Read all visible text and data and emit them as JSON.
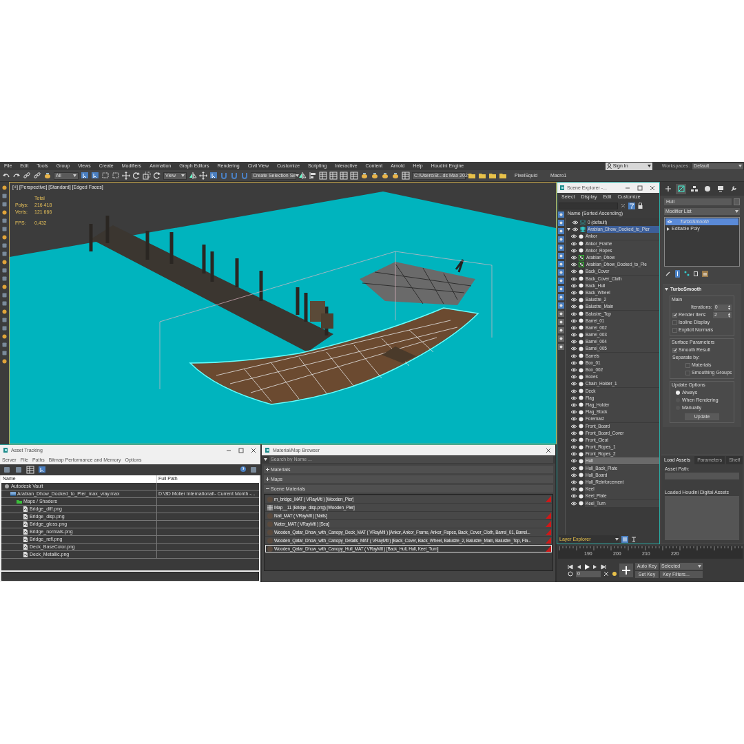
{
  "menu": [
    "File",
    "Edit",
    "Tools",
    "Group",
    "Views",
    "Create",
    "Modifiers",
    "Animation",
    "Graph Editors",
    "Rendering",
    "Civil View",
    "Customize",
    "Scripting",
    "Interactive",
    "Content",
    "Arnold",
    "Help",
    "Houdini Engine"
  ],
  "account": {
    "sign_in": "Sign In",
    "workspaces_label": "Workspaces:",
    "workspace": "Default"
  },
  "toolbar": {
    "selection_filter": "All",
    "reference_coord": "View",
    "selection_set": "Create Selection Se",
    "project_path": "C:\\Users\\St...ds Max 202",
    "buttons": [
      "PixelSquid",
      "Macro1"
    ]
  },
  "viewport": {
    "label": "[+] [Perspective] [Standard] [Edged Faces]",
    "total": "Total",
    "stats": [
      {
        "label": "Polys:",
        "value": "216 418"
      },
      {
        "label": "Verts:",
        "value": "121 666"
      }
    ],
    "fps_label": "FPS:",
    "fps": "0,432"
  },
  "scene_explorer": {
    "title": "Scene Explorer -...",
    "menu": [
      "Select",
      "Display",
      "Edit",
      "Customize"
    ],
    "column": "Name (Sorted Ascending)",
    "footer": "Layer Explorer",
    "tree": [
      {
        "name": "0 (default)",
        "kind": "layer",
        "selected": false
      },
      {
        "name": "Arabian_Dhow_Docked_to_Pier",
        "kind": "layer",
        "selected": true,
        "expanded": true,
        "children": [
          {
            "name": "Ankor",
            "kind": "object",
            "selected": false
          },
          {
            "name": "Ankor_Frame",
            "kind": "object",
            "selected": false
          },
          {
            "name": "Ankor_Ropes",
            "kind": "object",
            "selected": false
          },
          {
            "name": "Arabian_Dhow",
            "kind": "group",
            "selected": false
          },
          {
            "name": "Arabian_Dhow_Docked_to_Pie",
            "kind": "group",
            "selected": false
          },
          {
            "name": "Back_Cover",
            "kind": "object",
            "selected": false
          },
          {
            "name": "Back_Cover_Cloth",
            "kind": "object",
            "selected": false
          },
          {
            "name": "Back_Hull",
            "kind": "object",
            "selected": false
          },
          {
            "name": "Back_Wheel",
            "kind": "object",
            "selected": false
          },
          {
            "name": "Balustre_2",
            "kind": "object",
            "selected": false
          },
          {
            "name": "Balustre_Main",
            "kind": "object",
            "selected": false
          },
          {
            "name": "Balustre_Top",
            "kind": "object",
            "selected": false
          },
          {
            "name": "Barrel_01",
            "kind": "object",
            "selected": false
          },
          {
            "name": "Barrel_002",
            "kind": "object",
            "selected": false
          },
          {
            "name": "Barrel_003",
            "kind": "object",
            "selected": false
          },
          {
            "name": "Barrel_004",
            "kind": "object",
            "selected": false
          },
          {
            "name": "Barrel_005",
            "kind": "object",
            "selected": false
          },
          {
            "name": "Barrels",
            "kind": "object",
            "selected": false
          },
          {
            "name": "Box_01",
            "kind": "object",
            "selected": false
          },
          {
            "name": "Box_002",
            "kind": "object",
            "selected": false
          },
          {
            "name": "Boxes",
            "kind": "object",
            "selected": false
          },
          {
            "name": "Chain_Holder_1",
            "kind": "object",
            "selected": false
          },
          {
            "name": "Deck",
            "kind": "object",
            "selected": false
          },
          {
            "name": "Flag",
            "kind": "object",
            "selected": false
          },
          {
            "name": "Flag_Holder",
            "kind": "object",
            "selected": false
          },
          {
            "name": "Flag_Stock",
            "kind": "object",
            "selected": false
          },
          {
            "name": "Foremast",
            "kind": "object",
            "selected": false
          },
          {
            "name": "Front_Board",
            "kind": "object",
            "selected": false
          },
          {
            "name": "Front_Board_Cover",
            "kind": "object",
            "selected": false
          },
          {
            "name": "Front_Cleat",
            "kind": "object",
            "selected": false
          },
          {
            "name": "Front_Ropes_1",
            "kind": "object",
            "selected": false
          },
          {
            "name": "Front_Ropes_2",
            "kind": "object",
            "selected": false
          },
          {
            "name": "Hull",
            "kind": "object",
            "selected": true
          },
          {
            "name": "Hull_Back_Plate",
            "kind": "object",
            "selected": false
          },
          {
            "name": "Hull_Board",
            "kind": "object",
            "selected": false
          },
          {
            "name": "Hull_Reinforcement",
            "kind": "object",
            "selected": false
          },
          {
            "name": "Keel",
            "kind": "object",
            "selected": false
          },
          {
            "name": "Keel_Plate",
            "kind": "object",
            "selected": false
          },
          {
            "name": "Keel_Turn",
            "kind": "object",
            "selected": false
          }
        ]
      }
    ]
  },
  "command_panel": {
    "tabs": [
      {
        "kind": "create",
        "selected": false
      },
      {
        "kind": "modify",
        "selected": true
      },
      {
        "kind": "hierarchy",
        "selected": false
      },
      {
        "kind": "motion",
        "selected": false
      },
      {
        "kind": "display",
        "selected": false
      },
      {
        "kind": "utilities",
        "selected": false
      }
    ],
    "object_name": "Hull",
    "modifier_list": "Modifier List",
    "stack": [
      {
        "name": "TurboSmooth",
        "kind": "modifier",
        "selected": true
      },
      {
        "name": "Editable Poly",
        "kind": "base",
        "selected": false
      }
    ],
    "rollout": {
      "title": "TurboSmooth",
      "groups": [
        {
          "title": "Main",
          "controls": [
            {
              "kind": "spinner",
              "label": "Iterations:",
              "value": "0"
            },
            {
              "kind": "checked_spinner",
              "label": "Render Iters:",
              "value": "2",
              "checked": true
            },
            {
              "kind": "checkbox",
              "label": "Isoline Display",
              "checked": false
            },
            {
              "kind": "checkbox",
              "label": "Explicit Normals",
              "checked": false
            }
          ]
        },
        {
          "title": "Surface Parameters",
          "controls": [
            {
              "kind": "checkbox",
              "label": "Smooth Result",
              "checked": true
            },
            {
              "kind": "label",
              "label": "Separate by:"
            },
            {
              "kind": "sub_checkbox",
              "label": "Materials",
              "checked": false
            },
            {
              "kind": "sub_checkbox",
              "label": "Smoothing Groups",
              "checked": false
            }
          ]
        },
        {
          "title": "Update Options",
          "controls": [
            {
              "kind": "radio",
              "label": "Always",
              "selected": true
            },
            {
              "kind": "radio",
              "label": "When Rendering",
              "selected": false
            },
            {
              "kind": "radio",
              "label": "Manually",
              "selected": false
            },
            {
              "kind": "button",
              "label": "Update"
            }
          ]
        }
      ]
    },
    "houdini": {
      "tabs": [
        {
          "label": "Load Assets",
          "selected": true
        },
        {
          "label": "Parameters",
          "selected": false
        },
        {
          "label": "Shelf",
          "selected": false
        }
      ],
      "asset_path_label": "Asset Path:",
      "loaded_label": "Loaded Houdini Digital Assets"
    }
  },
  "asset_tracking": {
    "title": "Asset Tracking",
    "menu": [
      "Server",
      "File",
      "Paths",
      "Bitmap Performance and Memory",
      "Options"
    ],
    "columns": [
      "Name",
      "Full Path"
    ],
    "tree": [
      {
        "name": "Autodesk Vault",
        "kind": "vault",
        "children": [
          {
            "name": "Arabian_Dhow_Docked_to_Pier_max_vray.max",
            "kind": "scene",
            "path": "D:\\3D Molier International\\- Current Month -...",
            "children": [
              {
                "name": "Maps / Shaders",
                "kind": "folder",
                "children": [
                  {
                    "name": "Bridge_diff.png",
                    "kind": "bitmap"
                  },
                  {
                    "name": "Bridge_disp.png",
                    "kind": "bitmap"
                  },
                  {
                    "name": "Bridge_gloss.png",
                    "kind": "bitmap"
                  },
                  {
                    "name": "Bridge_normals.png",
                    "kind": "bitmap"
                  },
                  {
                    "name": "Bridge_refl.png",
                    "kind": "bitmap"
                  },
                  {
                    "name": "Deck_BaseColor.png",
                    "kind": "bitmap"
                  },
                  {
                    "name": "Deck_Metallic.png",
                    "kind": "bitmap"
                  }
                ]
              }
            ]
          }
        ]
      }
    ]
  },
  "material_browser": {
    "title": "Material/Map Browser",
    "search_placeholder": "Search by Name ...",
    "sections": [
      {
        "label": "Materials",
        "expanded": false
      },
      {
        "label": "Maps",
        "expanded": false
      },
      {
        "label": "Scene Materials",
        "expanded": true
      }
    ],
    "items": [
      {
        "name": "m_bridge_MAT ( VRayMtl ) [Wooden_Pier]",
        "kind": "material",
        "shown_in_viewport": true,
        "selected": false
      },
      {
        "name": "Map__11 (Bridge_disp.png) [Wooden_Pier]",
        "kind": "map",
        "shown_in_viewport": false,
        "selected": false
      },
      {
        "name": "Nail_MAT ( VRayMtl ) [Nails]",
        "kind": "material",
        "shown_in_viewport": true,
        "selected": false
      },
      {
        "name": "Water_MAT ( VRayMtl ) [Sea]",
        "kind": "material",
        "shown_in_viewport": true,
        "selected": false
      },
      {
        "name": "Wooden_Qatar_Dhow_with_Canopy_Deck_MAT ( VRayMtl ) [Ankor, Ankor_Frame, Ankor_Ropes, Back_Cover_Cloth, Barrel_01, Barrel...",
        "kind": "material",
        "shown_in_viewport": true,
        "selected": false
      },
      {
        "name": "Wooden_Qatar_Dhow_with_Canopy_Details_MAT ( VRayMtl ) [Back_Cover, Back_Wheel, Balustre_2, Balustre_Main, Balustre_Top, Fla...",
        "kind": "material",
        "shown_in_viewport": true,
        "selected": false
      },
      {
        "name": "Wooden_Qatar_Dhow_with_Canopy_Hull_MAT ( VRayMtl ) [Back_Hull, Hull, Keel_Turn]",
        "kind": "material",
        "shown_in_viewport": true,
        "selected": true
      }
    ]
  },
  "timeline": {
    "ticks": [
      "190",
      "200",
      "210",
      "220"
    ],
    "auto_key": "Auto Key",
    "key_mode": "Selected",
    "set_key": "Set Key",
    "key_filters": "Key Filters...",
    "frame": "0"
  }
}
